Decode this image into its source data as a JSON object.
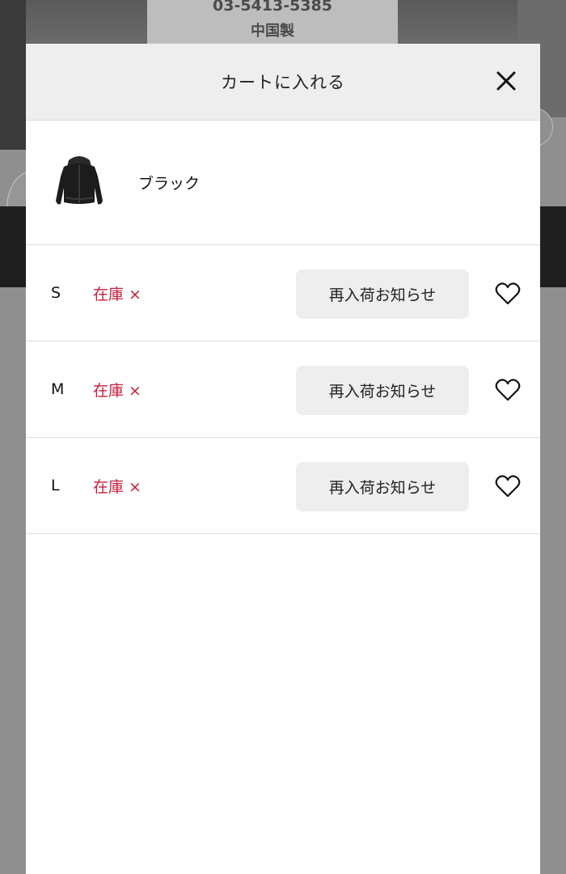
{
  "background": {
    "tag_phone": "03-5413-5385",
    "tag_origin": "中国製"
  },
  "modal": {
    "title": "カートに入れる",
    "close_icon": "close-icon",
    "product": {
      "color_name": "ブラック",
      "thumbnail": "black-hooded-jacket"
    },
    "sizes": [
      {
        "size": "S",
        "stock": "在庫 ×",
        "restock_label": "再入荷お知らせ",
        "favorite_icon": "heart-outline-icon"
      },
      {
        "size": "M",
        "stock": "在庫 ×",
        "restock_label": "再入荷お知らせ",
        "favorite_icon": "heart-outline-icon"
      },
      {
        "size": "L",
        "stock": "在庫 ×",
        "restock_label": "再入荷お知らせ",
        "favorite_icon": "heart-outline-icon"
      }
    ]
  },
  "colors": {
    "out_of_stock": "#c41e3a",
    "button_bg": "#eeeeee",
    "header_bg": "#eeeeee"
  }
}
